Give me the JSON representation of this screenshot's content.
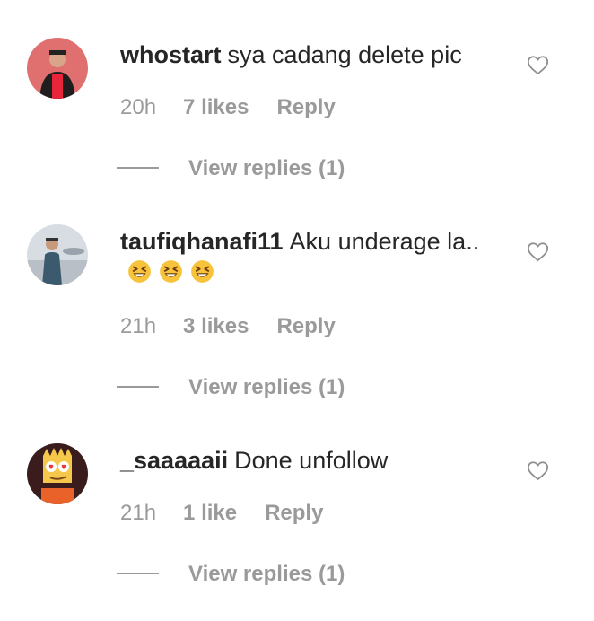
{
  "comments": [
    {
      "username": "whostart",
      "text": "sya cadang delete pic",
      "time": "20h",
      "likes": "7 likes",
      "reply": "Reply",
      "view_replies": "View replies (1)",
      "avatar_icon": "avatar-person-red-shirt",
      "heart_icon": "heart-outline-icon"
    },
    {
      "username": "taufiqhanafi11",
      "text": "Aku underage la..",
      "emojis": [
        "grinning-squinting-face",
        "grinning-squinting-face",
        "grinning-squinting-face"
      ],
      "time": "21h",
      "likes": "3 likes",
      "reply": "Reply",
      "view_replies": "View replies (1)",
      "avatar_icon": "avatar-person-airfield",
      "heart_icon": "heart-outline-icon"
    },
    {
      "username": "_saaaaaii",
      "text": "Done unfollow",
      "time": "21h",
      "likes": "1 like",
      "reply": "Reply",
      "view_replies": "View replies (1)",
      "avatar_icon": "avatar-cartoon-character",
      "heart_icon": "heart-outline-icon"
    }
  ],
  "colors": {
    "text": "#262626",
    "secondary": "#9a9a9a",
    "background": "#ffffff"
  }
}
